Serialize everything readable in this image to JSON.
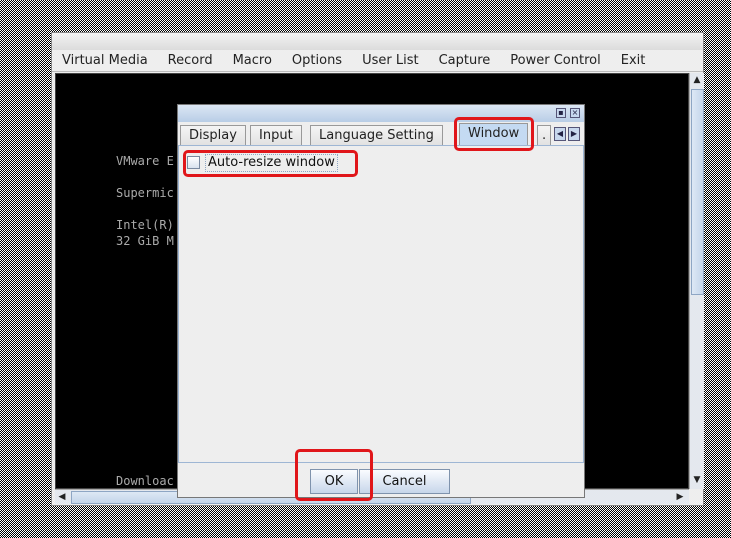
{
  "menubar": {
    "items": [
      "Virtual Media",
      "Record",
      "Macro",
      "Options",
      "User List",
      "Capture",
      "Power Control",
      "Exit"
    ]
  },
  "console": {
    "lines": [
      "VMware E",
      "Supermic",
      "Intel(R)",
      "32 GiB M",
      "Downloac"
    ]
  },
  "dialog": {
    "tabs": [
      {
        "label": "Display"
      },
      {
        "label": "Input"
      },
      {
        "label": "Language Setting"
      },
      {
        "label": "Window",
        "selected": true
      },
      {
        "label": "."
      }
    ],
    "checkbox": {
      "label": "Auto-resize window",
      "checked": false
    },
    "ok_label": "OK",
    "cancel_label": "Cancel"
  },
  "highlight_color": "#e0161a"
}
